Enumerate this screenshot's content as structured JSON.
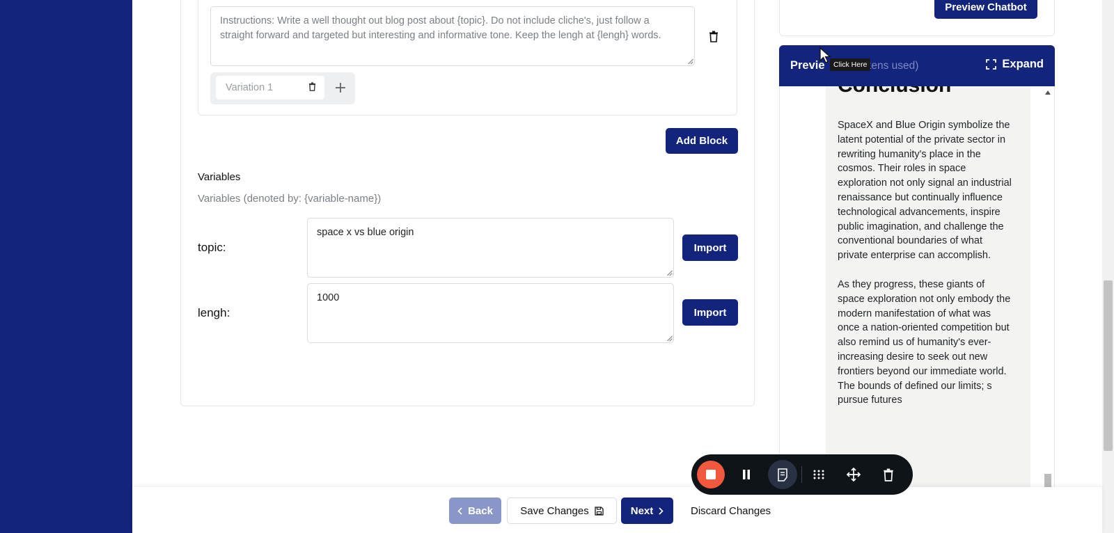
{
  "block": {
    "instructions_text": "Instructions:  Write a well thought out blog post about {topic}.  Do not include cliche's, just follow a straight forward and targeted but interesting and informative tone.  Keep the lengh at {lengh} words.",
    "variation_label": "Variation 1",
    "add_block_label": "Add Block"
  },
  "variables": {
    "title": "Variables",
    "subtitle": "Variables (denoted by: {variable-name})",
    "items": [
      {
        "label": "topic:",
        "value": "space x vs blue origin",
        "button": "Import"
      },
      {
        "label": "lengh:",
        "value": "1000",
        "button": "Import"
      }
    ]
  },
  "preview": {
    "chatbot_button": "Preview Chatbot",
    "title": "Previe",
    "tokens_text": "okens used)",
    "tooltip": "Click Here",
    "expand_label": "Expand",
    "partial_heading": "Conclusion",
    "paragraphs": [
      "SpaceX and Blue Origin symbolize the latent potential of the private sector in rewriting humanity's place in the cosmos. Their roles in space exploration not only signal an industrial renaissance but continually influence technological advancements, inspire public imagination, and challenge the conventional boundaries of what private enterprise can accomplish.",
      "As they progress, these giants of space exploration not only embody the modern manifestation of what was once a nation-oriented competition but also remind us of humanity's ever-increasing desire to seek out new frontiers beyond our immediate world. The bounds of defined our limits; s pursue futures"
    ]
  },
  "footer": {
    "back": "Back",
    "save": "Save Changes",
    "next": "Next",
    "discard": "Discard Changes"
  },
  "colors": {
    "navy": "#12247c",
    "record_red": "#f2583e",
    "toolbar_dark": "#0f1419"
  }
}
